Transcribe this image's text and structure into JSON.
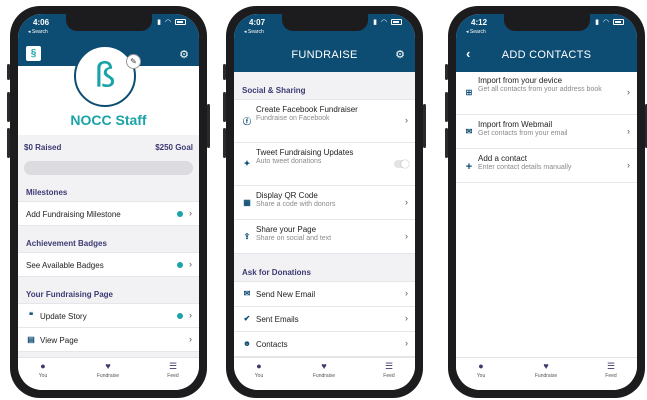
{
  "phone1": {
    "status": {
      "time": "4:06",
      "back": "◂ Search"
    },
    "profile": {
      "name": "NOCC Staff"
    },
    "fundraising": {
      "raised": "$0 Raised",
      "goal": "$250 Goal",
      "progress": 0
    },
    "sections": {
      "milestones": "Milestones",
      "badges": "Achievement Badges",
      "page": "Your Fundraising Page"
    },
    "rows": {
      "add_milestone": "Add Fundraising Milestone",
      "see_badges": "See Available Badges",
      "update_story": "Update Story",
      "view_page": "View Page"
    }
  },
  "phone2": {
    "status": {
      "time": "4:07",
      "back": "◂ Search"
    },
    "title": "FUNDRAISE",
    "sections": {
      "social": "Social & Sharing",
      "ask": "Ask for Donations"
    },
    "social_items": [
      {
        "title": "Create Facebook Fundraiser",
        "sub": "Fundraise on Facebook",
        "icon": "facebook-icon"
      },
      {
        "title": "Tweet Fundraising Updates",
        "sub": "Auto tweet donations",
        "icon": "twitter-icon"
      },
      {
        "title": "Display QR Code",
        "sub": "Share a code with donors",
        "icon": "qr-code-icon"
      },
      {
        "title": "Share your Page",
        "sub": "Share on social and text",
        "icon": "share-icon"
      }
    ],
    "ask_items": [
      {
        "title": "Send New Email",
        "icon": "envelope-icon"
      },
      {
        "title": "Sent Emails",
        "icon": "checkmark-icon"
      },
      {
        "title": "Contacts",
        "icon": "contacts-icon"
      }
    ]
  },
  "phone3": {
    "status": {
      "time": "4:12",
      "back": "◂ Search"
    },
    "title": "ADD CONTACTS",
    "items": [
      {
        "title": "Import from your device",
        "sub": "Get all contacts from your address book",
        "icon": "gift-icon"
      },
      {
        "title": "Import from Webmail",
        "sub": "Get contacts from your email",
        "icon": "envelope-icon"
      },
      {
        "title": "Add a contact",
        "sub": "Enter contact details manually",
        "icon": "plus-icon"
      }
    ]
  },
  "tabs": [
    {
      "label": "You",
      "icon": "person-icon"
    },
    {
      "label": "Fundraise",
      "icon": "heart-icon"
    },
    {
      "label": "Feed",
      "icon": "list-icon"
    }
  ],
  "colors": {
    "header": "#0e4d73",
    "accent": "#1aa3a8",
    "section": "#3c3a73"
  }
}
